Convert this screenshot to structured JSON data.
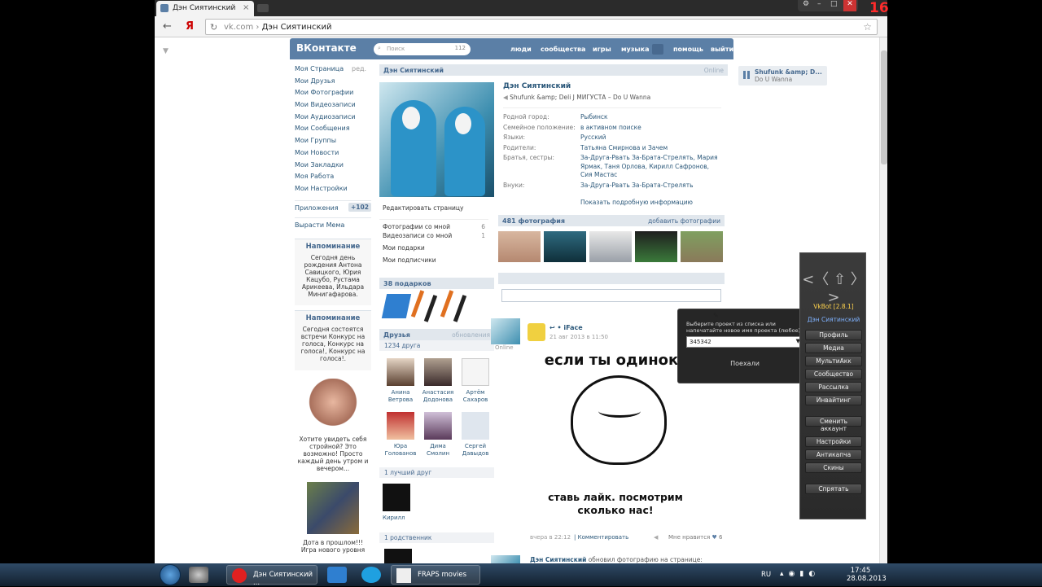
{
  "browser": {
    "tab_title": "Дэн Сиятинский",
    "tab_close": "×",
    "address_host": "vk.com",
    "address_sep": " › ",
    "address_path": "Дэн Сиятинский",
    "back": "←",
    "yandex": "Я"
  },
  "vk": {
    "logo": "ВКонтакте",
    "search_placeholder": "Поиск",
    "search_count": "112",
    "nav": [
      "люди",
      "сообщества",
      "игры",
      "музыка",
      "помощь",
      "выйти"
    ]
  },
  "sidebar": {
    "items": [
      "Моя Страница",
      "Мои Друзья",
      "Мои Фотографии",
      "Мои Видеозаписи",
      "Мои Аудиозаписи",
      "Мои Сообщения",
      "Мои Группы",
      "Мои Новости",
      "Мои Закладки",
      "Моя Работа",
      "Мои Настройки"
    ],
    "edit": "ред.",
    "apps": "Приложения",
    "apps_badge": "+102",
    "grow": "Вырасти Мема",
    "reminder1_title": "Напоминание",
    "reminder1_text": "Сегодня день рождения Антона Савицкого, Юрия Кацубо, Рустама Арикеева, Ильдара Минигафарова.",
    "reminder2_title": "Напоминание",
    "reminder2_text": "Сегодня состоятся встречи Конкурс на голоса, Конкурс на голоса!, Конкурс на голоса!.",
    "ad1_text": "Хотите увидеть себя стройной? Это возможно! Просто каждый день утром и вечером...",
    "ad2_text": "Дота в прошлом!!! Игра нового уровня"
  },
  "profile": {
    "header_name": "Дэн Сиятинский",
    "header_online": "Online",
    "name": "Дэн Сиятинский",
    "status": "Shufunk &amp; Deli J МИГУСТА – Do U Wanna",
    "rows": [
      {
        "k": "Родной город:",
        "v": "Рыбинск"
      },
      {
        "k": "Семейное положение:",
        "v": "в активном поиске"
      },
      {
        "k": "Языки:",
        "v": "Русский"
      },
      {
        "k": "Родители:",
        "v": "Татьяна Смирнова и Зачем"
      },
      {
        "k": "Братья, сестры:",
        "v": "За-Друга-Рвать За-Брата-Стрелять, Мария Ярмак, Таня Орлова, Кирилл Сафронов, Сия Мастас"
      },
      {
        "k": "Внуки:",
        "v": "За-Друга-Рвать За-Брата-Стрелять"
      }
    ],
    "show_more": "Показать подробную информацию",
    "edit_page": "Редактировать страницу",
    "left_items": [
      {
        "label": "Фотографии со мной",
        "n": "6"
      },
      {
        "label": "Видеозаписи со мной",
        "n": "1"
      },
      {
        "label": "Мои подарки",
        "n": ""
      },
      {
        "label": "Мои подписчики",
        "n": ""
      }
    ],
    "photos_title": "481 фотография",
    "photos_add": "добавить фотографии",
    "gifts_title": "38 подарков",
    "friends_title": "Друзья",
    "friends_updates": "обновления",
    "friends_count": "1234 друга",
    "friends": [
      {
        "first": "Анина",
        "last": "Ветрова"
      },
      {
        "first": "Анастасия",
        "last": "Додонова"
      },
      {
        "first": "Артём",
        "last": "Сахаров"
      },
      {
        "first": "Юра",
        "last": "Голованов"
      },
      {
        "first": "Дима",
        "last": "Смолин"
      },
      {
        "first": "Сергей",
        "last": "Давыдов"
      }
    ],
    "best_friend_title": "1 лучший друг",
    "best_friend": "Кирилл",
    "relative_title": "1 родственник",
    "online_label": "Online"
  },
  "post": {
    "author": "iFace",
    "date": "21 авг 2013 в 11:50",
    "text1": "если ты одинок",
    "text2": "ставь лайк. посмотрим сколько нас!",
    "footer_time": "вчера в 22:12",
    "comment": "Комментировать",
    "likes_label": "Мне нравится",
    "likes": "6",
    "next_author": "Дэн Сиятинский",
    "next_text": "обновил фотографию на странице:"
  },
  "dialog": {
    "text": "Выберите проект из списка или напечатайте новое имя проекта (любое):",
    "value": "345342",
    "button": "Поехали"
  },
  "audio": {
    "title": "Shufunk &amp; D...",
    "subtitle": "Do U Wanna"
  },
  "vkbot": {
    "logo": "<〈 ⇧ 〉>",
    "version": "VkBot [2.8.1]",
    "user": "Дэн Сиятинский",
    "buttons": [
      "Профиль",
      "Медиа",
      "МультиАкк",
      "Сообщество",
      "Рассылка",
      "Инвайтинг",
      "Сменить аккаунт",
      "Настройки",
      "Антикапча",
      "Скины",
      "Спрятать"
    ]
  },
  "fraps": "16",
  "taskbar": {
    "items": [
      "Дэн Сиятинский ...",
      "FRAPS movies"
    ],
    "lang": "RU",
    "time": "17:45",
    "date": "28.08.2013"
  },
  "colors": {
    "vk_blue": "#5b7fa6",
    "link": "#2b587a",
    "fraps_red": "#ff2b2b"
  }
}
